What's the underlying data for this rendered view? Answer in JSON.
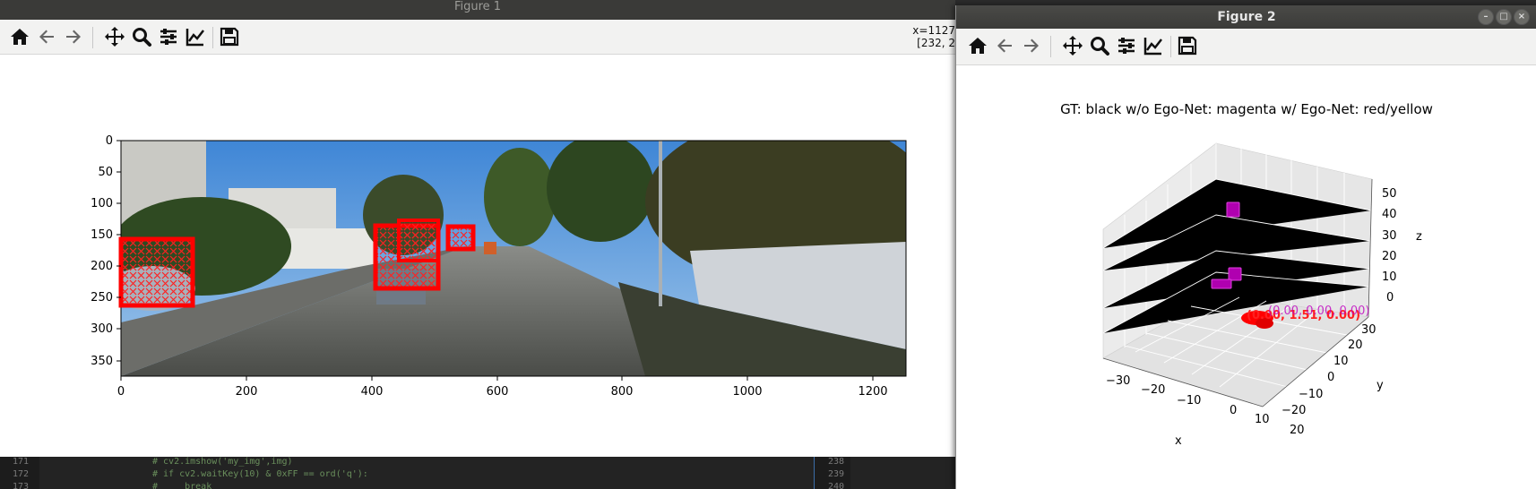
{
  "figure1": {
    "title": "Figure 1",
    "coord_readout": "x=1127\n[232, 2",
    "x_ticks": [
      "0",
      "200",
      "400",
      "600",
      "800",
      "1000",
      "1200"
    ],
    "y_ticks": [
      "0",
      "50",
      "100",
      "150",
      "200",
      "250",
      "300",
      "350"
    ]
  },
  "figure2": {
    "title": "Figure 2",
    "plot_title": "GT: black w/o Ego-Net: magenta w/ Ego-Net: red/yellow",
    "x_label": "x",
    "y_label": "y",
    "z_label": "z",
    "x_ticks": [
      "−30",
      "−20",
      "−10",
      "0",
      "10",
      "20"
    ],
    "y_ticks": [
      "30",
      "20",
      "10",
      "0",
      "−10",
      "−20"
    ],
    "z_ticks": [
      "50",
      "40",
      "30",
      "20",
      "10",
      "0"
    ],
    "annotation_1": "(0.00, 0.00, 0.00)",
    "annotation_2": "(0.00, 1.51, 0.00)"
  },
  "toolbar_icons": [
    "home-icon",
    "back-icon",
    "forward-icon",
    "pan-icon",
    "zoom-icon",
    "configure-subplots-icon",
    "edit-axis-icon",
    "save-icon"
  ],
  "editor": {
    "left_numbers": [
      "171",
      "172",
      "173"
    ],
    "left_code": [
      "# cv2.imshow('my_img',img)",
      "# if cv2.waitKey(10) & 0xFF == ord('q'):",
      "#     break"
    ],
    "right_numbers": [
      "238",
      "239",
      "240"
    ]
  },
  "colors": {
    "box_red": "#ff0000",
    "magenta": "#c000c0",
    "toolbar_bg": "#f2f2f1"
  }
}
